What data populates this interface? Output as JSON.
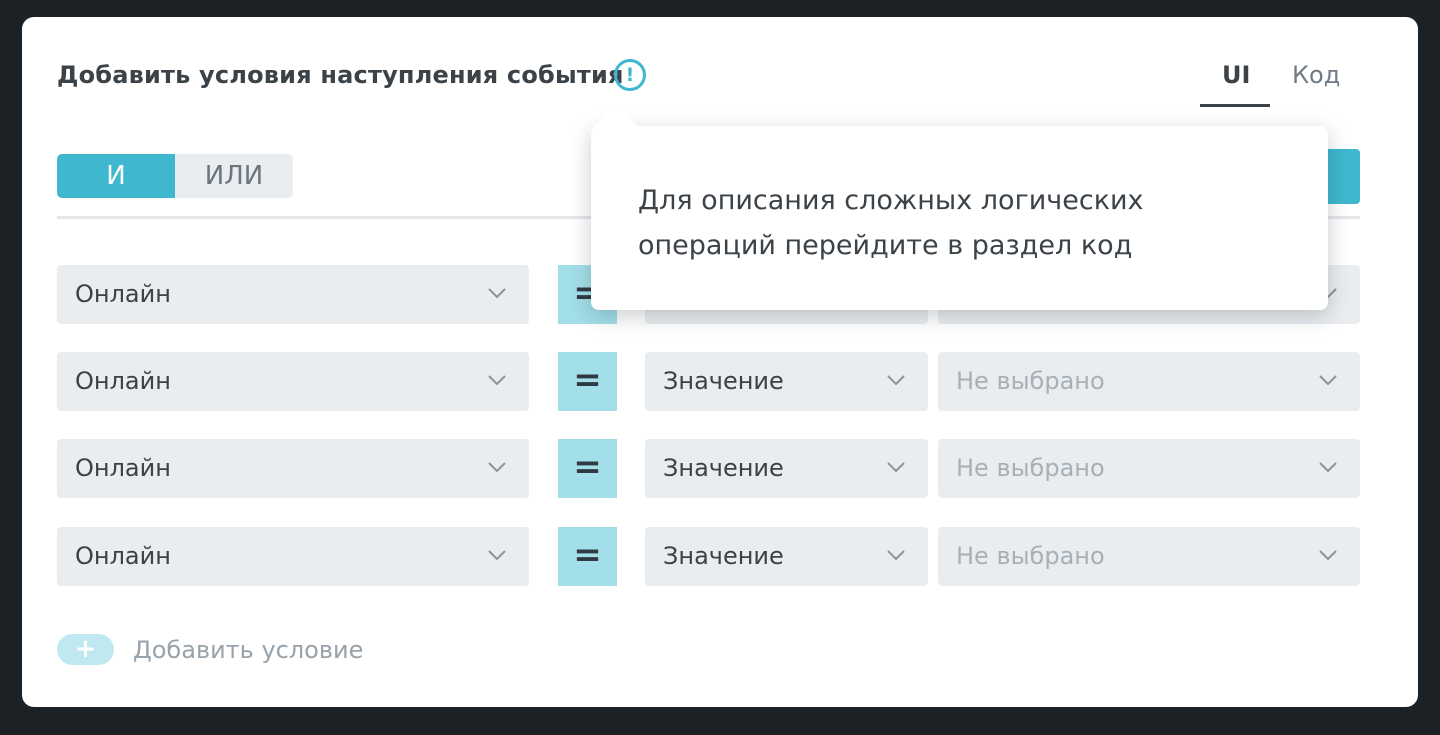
{
  "header": {
    "title": "Добавить условия наступления события",
    "info_icon": "exclamation-circle-icon",
    "info_glyph": "!",
    "view_tabs": [
      {
        "label": "UI",
        "active": true
      },
      {
        "label": "Код",
        "active": false
      }
    ]
  },
  "logic": {
    "and_label": "И",
    "or_label": "ИЛИ",
    "selected": "И"
  },
  "conditions": [
    {
      "field": "Онлайн",
      "operator": "=",
      "mode": "",
      "value": ""
    },
    {
      "field": "Онлайн",
      "operator": "=",
      "mode": "Значение",
      "value": "Не выбрано"
    },
    {
      "field": "Онлайн",
      "operator": "=",
      "mode": "Значение",
      "value": "Не выбрано"
    },
    {
      "field": "Онлайн",
      "operator": "=",
      "mode": "Значение",
      "value": "Не выбрано"
    }
  ],
  "add_condition": {
    "icon_glyph": "+",
    "label": "Добавить условие"
  },
  "tooltip": {
    "line1": "Для описания сложных логических",
    "line2": "операций перейдите в раздел код"
  },
  "colors": {
    "accent": "#3fb8cf",
    "operator_bg": "#a3dfe9",
    "select_bg": "#e9edf0",
    "text": "#3b4248",
    "placeholder": "#a8b0b7"
  }
}
